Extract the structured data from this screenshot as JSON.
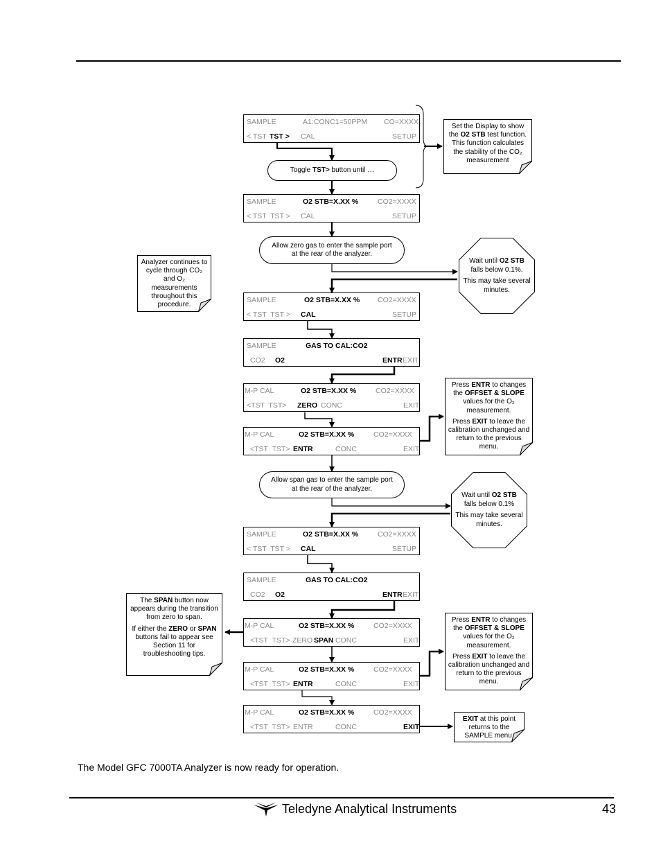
{
  "body_text": "The Model GFC 7000TA Analyzer is now ready for operation.",
  "footer": {
    "company": "Teledyne Analytical Instruments",
    "page_number": "43",
    "logo_icon": "teledyne-logo-icon"
  },
  "screens": [
    {
      "r1": [
        {
          "t": "SAMPLE"
        },
        {
          "t": "A1:CONC1=50PPM"
        },
        {
          "t": "CO=XXXX"
        }
      ],
      "r2": [
        {
          "t": "< TST"
        },
        {
          "t": "TST >",
          "b": true
        },
        {
          "t": "CAL"
        },
        {
          "t": "SETUP"
        }
      ]
    },
    {
      "r1": [
        {
          "t": "SAMPLE"
        },
        {
          "t": "O2 STB=X.XX %",
          "b": true
        },
        {
          "t": "CO2=XXXX"
        }
      ],
      "r2": [
        {
          "t": "< TST  TST >"
        },
        {
          "t": "CAL"
        },
        {
          "t": "SETUP"
        }
      ]
    },
    {
      "r1": [
        {
          "t": "SAMPLE"
        },
        {
          "t": "O2 STB=X.XX %",
          "b": true
        },
        {
          "t": "CO2=XXXX"
        }
      ],
      "r2": [
        {
          "t": "< TST  TST >"
        },
        {
          "t": "CAL",
          "b": true
        },
        {
          "t": "SETUP"
        }
      ]
    },
    {
      "r1": [
        {
          "t": "SAMPLE"
        },
        {
          "t": "GAS TO CAL:CO2",
          "b": true
        }
      ],
      "r2": [
        {
          "t": "CO2"
        },
        {
          "t": "O2",
          "b": true
        },
        {
          "t": "ENTR",
          "b": true
        },
        {
          "t": "EXIT"
        }
      ]
    },
    {
      "r1": [
        {
          "t": "M-P CAL"
        },
        {
          "t": "O2 STB=X.XX %",
          "b": true
        },
        {
          "t": "CO2=XXXX"
        }
      ],
      "r2": [
        {
          "t": "<TST  TST>"
        },
        {
          "t": "ZERO",
          "b": true
        },
        {
          "t": "CONC"
        },
        {
          "t": "EXIT"
        }
      ]
    },
    {
      "r1": [
        {
          "t": "M-P CAL"
        },
        {
          "t": "O2 STB=X.XX %",
          "b": true
        },
        {
          "t": "CO2=XXXX"
        }
      ],
      "r2": [
        {
          "t": "<TST  TST>"
        },
        {
          "t": "ENTR",
          "b": true
        },
        {
          "t": "CONC"
        },
        {
          "t": "EXIT"
        }
      ]
    },
    {
      "r1": [
        {
          "t": "SAMPLE"
        },
        {
          "t": "O2 STB=X.XX %",
          "b": true
        },
        {
          "t": "CO2=XXXX"
        }
      ],
      "r2": [
        {
          "t": "< TST  TST >"
        },
        {
          "t": "CAL",
          "b": true
        },
        {
          "t": "SETUP"
        }
      ]
    },
    {
      "r1": [
        {
          "t": "SAMPLE"
        },
        {
          "t": "GAS TO CAL:CO2",
          "b": true
        }
      ],
      "r2": [
        {
          "t": "CO2"
        },
        {
          "t": "O2",
          "b": true
        },
        {
          "t": "ENTR",
          "b": true
        },
        {
          "t": "EXIT"
        }
      ]
    },
    {
      "r1": [
        {
          "t": "M-P CAL"
        },
        {
          "t": "O2 STB=X.XX %",
          "b": true
        },
        {
          "t": "CO2=XXXX"
        }
      ],
      "r2": [
        {
          "t": "<TST  TST>"
        },
        {
          "t": "ZERO"
        },
        {
          "t": "SPAN",
          "b": true
        },
        {
          "t": "CONC"
        },
        {
          "t": "EXIT"
        }
      ]
    },
    {
      "r1": [
        {
          "t": "M-P CAL"
        },
        {
          "t": "O2 STB=X.XX %",
          "b": true
        },
        {
          "t": "CO2=XXXX"
        }
      ],
      "r2": [
        {
          "t": "<TST  TST>"
        },
        {
          "t": "ENTR",
          "b": true
        },
        {
          "t": "CONC"
        },
        {
          "t": "EXIT"
        }
      ]
    },
    {
      "r1": [
        {
          "t": "M-P CAL"
        },
        {
          "t": "O2 STB=X.XX %",
          "b": true
        },
        {
          "t": "CO2=XXXX"
        }
      ],
      "r2": [
        {
          "t": "<TST  TST>"
        },
        {
          "t": "ENTR"
        },
        {
          "t": "CONC"
        },
        {
          "t": "EXIT",
          "b": true
        }
      ]
    }
  ],
  "pills": [
    [
      [
        {
          "t": "Toggle "
        },
        {
          "t": "TST>",
          "b": true
        },
        {
          "t": " button until …"
        }
      ]
    ],
    [
      [
        {
          "t": "Allow zero gas to enter the sample port"
        }
      ],
      [
        {
          "t": "at the rear of the analyzer."
        }
      ]
    ],
    [
      [
        {
          "t": "Allow span gas to enter the sample port"
        }
      ],
      [
        {
          "t": "at the rear of the analyzer."
        }
      ]
    ]
  ],
  "notes": [
    [
      [
        {
          "t": "Set the Display to show"
        }
      ],
      [
        {
          "t": "the "
        },
        {
          "t": "O2 STB",
          "b": true
        },
        {
          "t": " test function."
        }
      ],
      [
        {
          "t": "This function calculates"
        }
      ],
      [
        {
          "t": "the stability of the CO₂"
        }
      ],
      [
        {
          "t": "measurement"
        }
      ]
    ],
    [
      [
        {
          "t": "Analyzer continues to"
        }
      ],
      [
        {
          "t": "cycle through CO₂"
        }
      ],
      [
        {
          "t": "and O₂"
        }
      ],
      [
        {
          "t": "measurements"
        }
      ],
      [
        {
          "t": "throughout this"
        }
      ],
      [
        {
          "t": "procedure."
        }
      ]
    ],
    [
      [
        {
          "t": "Press "
        },
        {
          "t": "ENTR",
          "b": true
        },
        {
          "t": " to changes"
        }
      ],
      [
        {
          "t": "the "
        },
        {
          "t": "OFFSET & SLOPE",
          "b": true
        }
      ],
      [
        {
          "t": "values for the O₂"
        }
      ],
      [
        {
          "t": "measurement."
        }
      ],
      [],
      [
        {
          "t": "Press "
        },
        {
          "t": "EXIT",
          "b": true
        },
        {
          "t": " to leave the"
        }
      ],
      [
        {
          "t": "calibration unchanged and"
        }
      ],
      [
        {
          "t": "return to the previous"
        }
      ],
      [
        {
          "t": "menu."
        }
      ]
    ],
    [
      [
        {
          "t": "The "
        },
        {
          "t": "SPAN",
          "b": true
        },
        {
          "t": " button now"
        }
      ],
      [
        {
          "t": "appears during the transition"
        }
      ],
      [
        {
          "t": "from zero to span."
        }
      ],
      [],
      [
        {
          "t": "If either the "
        },
        {
          "t": "ZERO",
          "b": true
        },
        {
          "t": " or "
        },
        {
          "t": "SPAN",
          "b": true
        }
      ],
      [
        {
          "t": "buttons fail to appear see"
        }
      ],
      [
        {
          "t": "Section 11 for"
        }
      ],
      [
        {
          "t": "troubleshooting tips."
        }
      ]
    ],
    [
      [
        {
          "t": "Press "
        },
        {
          "t": "ENTR",
          "b": true
        },
        {
          "t": " to changes"
        }
      ],
      [
        {
          "t": "the "
        },
        {
          "t": "OFFSET & SLOPE",
          "b": true
        }
      ],
      [
        {
          "t": "values for the O₂"
        }
      ],
      [
        {
          "t": "measurement."
        }
      ],
      [],
      [
        {
          "t": "Press "
        },
        {
          "t": "EXIT",
          "b": true
        },
        {
          "t": " to leave the"
        }
      ],
      [
        {
          "t": "calibration unchanged and"
        }
      ],
      [
        {
          "t": "return to the previous"
        }
      ],
      [
        {
          "t": "menu."
        }
      ]
    ],
    [
      [
        {
          "t": "EXIT",
          "b": true
        },
        {
          "t": " at this point"
        }
      ],
      [
        {
          "t": "returns to the"
        }
      ],
      [
        {
          "t": "SAMPLE menu."
        }
      ]
    ]
  ],
  "octagons": [
    [
      [
        {
          "t": "Wait until "
        },
        {
          "t": "O2 STB",
          "b": true
        }
      ],
      [
        {
          "t": "falls below 0.1%."
        }
      ],
      [],
      [
        {
          "t": "This may take several"
        }
      ],
      [
        {
          "t": "minutes."
        }
      ]
    ],
    [
      [
        {
          "t": "Wait until "
        },
        {
          "t": "O2 STB",
          "b": true
        }
      ],
      [
        {
          "t": "falls below 0.1%"
        }
      ],
      [],
      [
        {
          "t": "This may take several"
        }
      ],
      [
        {
          "t": "minutes."
        }
      ]
    ]
  ]
}
